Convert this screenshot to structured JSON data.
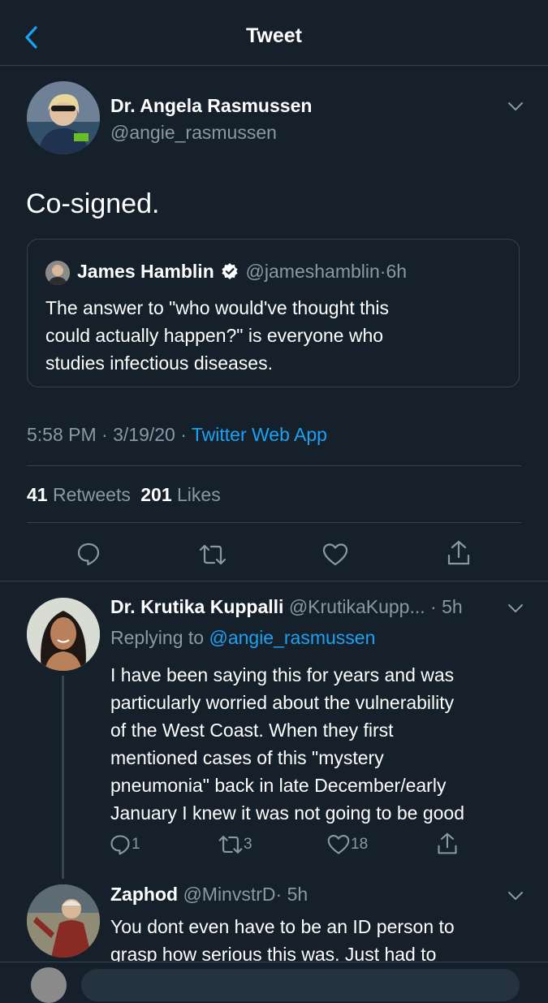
{
  "header": {
    "title": "Tweet",
    "back_icon": "back-chevron-icon"
  },
  "tweet": {
    "author_name": "Dr. Angela Rasmussen",
    "author_handle": "@angie_rasmussen",
    "text": "Co-signed.",
    "quote": {
      "author_name": "James Hamblin",
      "author_handle": "@jameshamblin",
      "separator": "·",
      "time": "6h",
      "text_line1": "The answer to \"who would've thought this",
      "text_line2": "could actually happen?\" is everyone who",
      "text_line3": "studies infectious diseases."
    },
    "timestamp": "5:58 PM · 3/19/20 ·",
    "source": "Twitter Web App",
    "retweet_count": "41",
    "retweet_label": "Retweets",
    "like_count": "201",
    "like_label": "Likes"
  },
  "replies": [
    {
      "author_name": "Dr. Krutika Kuppalli",
      "author_handle": "@KrutikaKupp...",
      "time": "· 5h",
      "replying_prefix": "Replying to",
      "replying_handle": "@angie_rasmussen",
      "lines": [
        "I have been saying this for years and was",
        "particularly worried about the vulnerability",
        "of the West Coast. When they first",
        "mentioned cases of this \"mystery",
        "pneumonia\" back in late December/early",
        "January I knew it was not going to be good"
      ],
      "reply_count": "1",
      "retweet_count": "3",
      "like_count": "18"
    },
    {
      "author_name": "Zaphod",
      "author_handle": "@MinvstrD",
      "time": "· 5h",
      "lines": [
        "You dont even have to be an ID person to",
        "grasp how serious this was. Just had to"
      ]
    }
  ],
  "colors": {
    "background": "#15202b",
    "divider": "#38444d",
    "accent": "#1da1f2",
    "muted": "#8899a6"
  }
}
